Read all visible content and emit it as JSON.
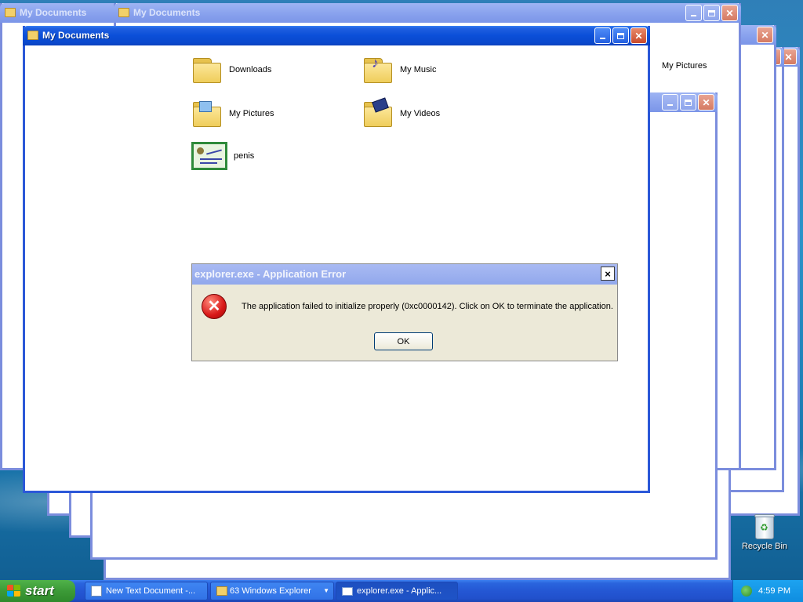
{
  "windows": {
    "title": "My Documents",
    "background_titles": [
      "My Documents",
      "My Documents"
    ]
  },
  "main_window": {
    "title": "My Documents",
    "items": [
      {
        "label": "Downloads",
        "icon": "folder-icon"
      },
      {
        "label": "My Music",
        "icon": "music-folder-icon"
      },
      {
        "label": "My Pictures",
        "icon": "pictures-folder-icon"
      },
      {
        "label": "My Videos",
        "icon": "videos-folder-icon"
      },
      {
        "label": "penis",
        "icon": "certificate-icon"
      }
    ]
  },
  "background_window": {
    "visible_item": "My Pictures"
  },
  "dialog": {
    "title": "explorer.exe - Application Error",
    "message": "The application failed to initialize properly (0xc0000142). Click on OK to terminate the application.",
    "ok_label": "OK",
    "close_symbol": "×",
    "icon": "error-icon"
  },
  "desktop": {
    "recycle_bin_label": "Recycle Bin"
  },
  "taskbar": {
    "start_label": "start",
    "tasks": [
      {
        "label": "New Text Document -...",
        "icon": "notepad-icon"
      },
      {
        "label": "63 Windows Explorer",
        "icon": "folder-icon",
        "count": "63"
      },
      {
        "label": "explorer.exe - Applic...",
        "icon": "window-icon",
        "active": true
      }
    ],
    "clock": "4:59 PM"
  },
  "colors": {
    "titlebar_active": "#0b4fd8",
    "titlebar_inactive": "#7b95e8",
    "dialog_face": "#ece9d8",
    "taskbar": "#2457d4",
    "start_button": "#3c9a37",
    "tray": "#0f8de0"
  }
}
